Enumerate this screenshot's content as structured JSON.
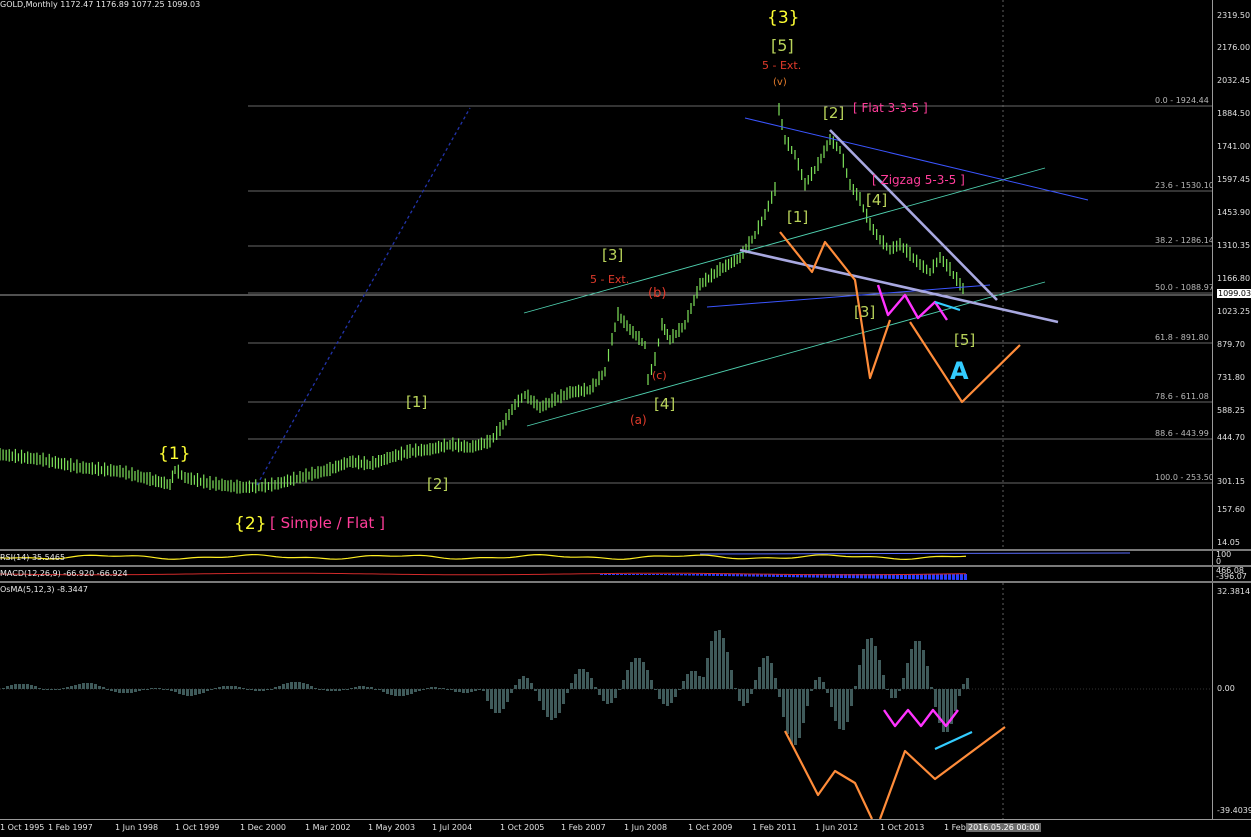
{
  "header": {
    "main": "GOLD,Monthly  1172.47 1176.89 1077.25 1099.03",
    "rsi": "RSI(14) 35.5465",
    "macd": "MACD(12,26,9) -66.920 -66.924",
    "osma": "OsMA(5,12,3) -8.3447"
  },
  "price_axis_labels": [
    "2319.50",
    "2176.00",
    "2032.45",
    "1884.50",
    "1741.00",
    "1597.45",
    "1453.90",
    "1310.35",
    "1166.80",
    "1099.03",
    "1023.25",
    "879.70",
    "731.80",
    "588.25",
    "444.70",
    "301.15",
    "157.60",
    "14.05"
  ],
  "rsi_axis_labels": [
    "100",
    "0"
  ],
  "macd_axis_labels": [
    "466.08",
    "-396.07"
  ],
  "osma_axis_labels": [
    "32.3814",
    "0.00",
    "-39.4039"
  ],
  "time_axis_labels": [
    "1 Oct 1995",
    "1 Feb 1997",
    "1 Jun 1998",
    "1 Oct 1999",
    "1 Dec 2000",
    "1 Mar 2002",
    "1 May 2003",
    "1 Jul 2004",
    "1 Oct 2005",
    "1 Feb 2007",
    "1 Jun 2008",
    "1 Oct 2009",
    "1 Feb 2011",
    "1 Jun 2012",
    "1 Oct 2013",
    "1 Feb 2016"
  ],
  "cursor_time": "2016.05.26 00:00",
  "fib_levels": [
    {
      "label": "0.0 - 1924.44",
      "price": 1924.44
    },
    {
      "label": "23.6 - 1530.10",
      "price": 1530.1
    },
    {
      "label": "38.2 - 1286.14",
      "price": 1286.14
    },
    {
      "label": "50.0 - 1088.97",
      "price": 1088.97
    },
    {
      "label": "61.8 - 891.80",
      "price": 891.8
    },
    {
      "label": "78.6 - 611.08",
      "price": 611.08
    },
    {
      "label": "88.6 - 443.99",
      "price": 443.99
    },
    {
      "label": "100.0 - 253.50",
      "price": 253.5
    }
  ],
  "annotations": {
    "wave3_top": "{3}",
    "wave5_top": "[5]",
    "ext_top": "5 - Ext.",
    "v_top": "(v)",
    "flat": "[ Flat 3-3-5 ]",
    "zigzag": "[ Zigzag 5-3-5 ]",
    "wave2_sq": "[2]",
    "wave1_sq": "[1]",
    "wave4_sq": "[4]",
    "wave3_sq_lower": "[3]",
    "wave5_sq_lower": "[5]",
    "wave3_sq_mid": "[3]",
    "ext_mid": "5 - Ext.",
    "wave4_sq_mid": "[4]",
    "b_paren": "(b)",
    "c_paren": "(c)",
    "a_paren": "(a)",
    "wave1_sq_early": "[1]",
    "wave2_sq_early": "[2]",
    "wave1_curly": "{1}",
    "wave2_curly": "{2}",
    "simple_flat": "[ Simple / Flat ]",
    "script_a": "A"
  },
  "colors": {
    "background": "#000000",
    "candle": "#7ee35a",
    "yellow": "#ffff33",
    "olive": "#b9d35a",
    "red": "#e23b2b",
    "orange_wave": "#ff8c3a",
    "magenta": "#ff33ff",
    "cyan": "#33ccff",
    "blue_line": "#3b55ff",
    "lavender": "#a8a8e0",
    "pink": "#ff3d9a"
  },
  "chart_data": {
    "type": "line",
    "symbol": "GOLD",
    "timeframe": "Monthly",
    "last_bar": {
      "open": 1172.47,
      "high": 1176.89,
      "low": 1077.25,
      "close": 1099.03
    },
    "approx_price_path": {
      "x": [
        "1995-10",
        "1997-02",
        "1998-06",
        "1999-10",
        "2000-12",
        "2002-03",
        "2003-05",
        "2004-07",
        "2005-10",
        "2007-02",
        "2008-06",
        "2009-10",
        "2011-08",
        "2012-10",
        "2013-10",
        "2015-11"
      ],
      "y": [
        385,
        350,
        295,
        300,
        270,
        300,
        360,
        400,
        470,
        660,
        880,
        1050,
        1900,
        1720,
        1280,
        1080
      ]
    },
    "osma": {
      "last": -8.3447,
      "max": 32.3814,
      "min": -39.4039
    }
  }
}
